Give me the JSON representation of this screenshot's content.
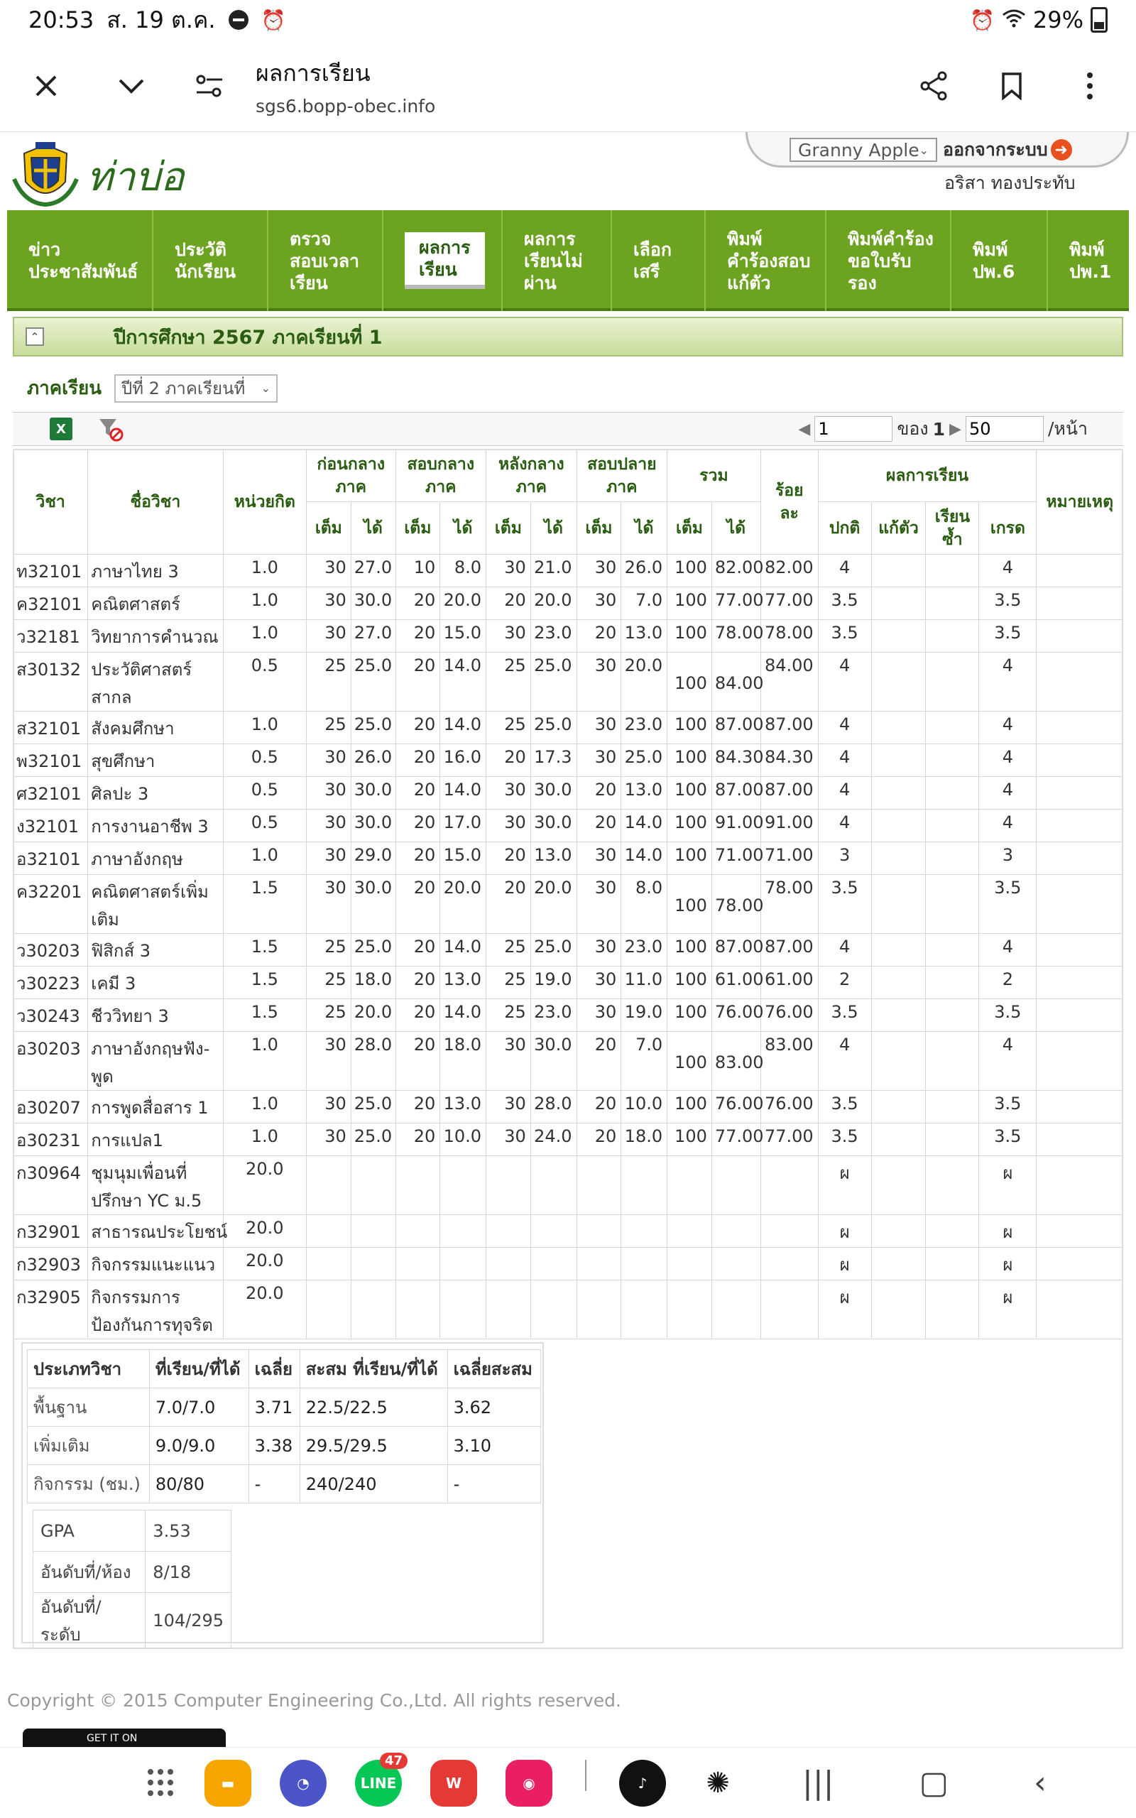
{
  "status": {
    "time": "20:53",
    "date": "ส. 19 ต.ค.",
    "battery": "29%"
  },
  "browser": {
    "page_title": "ผลการเรียน",
    "url": "sgs6.bopp-obec.info"
  },
  "site": {
    "name": "ท่าบ่อ",
    "theme": "Granny Apple",
    "logout": "ออกจากระบบ",
    "user": "อริสา  ทองประทับ"
  },
  "nav": [
    "ข่าว\nประชาสัมพันธ์",
    "ประวัติ\nนักเรียน",
    "ตรวจ\nสอบเวลา\nเรียน",
    "ผลการ\nเรียน",
    "ผลการ\nเรียนไม่\nผ่าน",
    "เลือก\nเสรี",
    "พิมพ์\nคำร้องสอบ\nแก้ตัว",
    "พิมพ์คำร้อง\nขอใบรับ\nรอง",
    "พิมพ์\nปพ.6",
    "พิมพ์\nปพ.1"
  ],
  "term_title": "ปีการศึกษา 2567  ภาคเรียนที่  1",
  "filter": {
    "label": "ภาคเรียน",
    "value": "ปีที่  2  ภาคเรียนที่"
  },
  "pager": {
    "page": "1",
    "of_label": "ของ",
    "total_pages": "1",
    "per_page": "50",
    "per_page_label": "/หน้า"
  },
  "table": {
    "headers": {
      "code": "วิชา",
      "name": "ชื่อวิชา",
      "credit": "หน่วยกิต",
      "pre_mid": "ก่อนกลาง\nภาค",
      "mid": "สอบกลาง\nภาค",
      "post_mid": "หลังกลาง\nภาค",
      "final": "สอบปลาย\nภาค",
      "total": "รวม",
      "percent": "ร้อย\nละ",
      "result": "ผลการเรียน",
      "note": "หมายเหตุ",
      "full": "เต็ม",
      "got": "ได้",
      "normal": "ปกติ",
      "retest": "แก้ตัว",
      "repeat": "เรียน\nซ้ำ",
      "grade": "เกรด"
    },
    "rows": [
      {
        "code": "ท32101",
        "name": "ภาษาไทย  3",
        "credit": "1.0",
        "s": [
          "30",
          "27.0",
          "10",
          "8.0",
          "30",
          "21.0",
          "30",
          "26.0",
          "100",
          "82.00"
        ],
        "pct": "82.00",
        "normal": "4",
        "retest": "",
        "repeat": "",
        "grade": "4",
        "note": ""
      },
      {
        "code": "ค32101",
        "name": "คณิตศาสตร์",
        "credit": "1.0",
        "s": [
          "30",
          "30.0",
          "20",
          "20.0",
          "20",
          "20.0",
          "30",
          "7.0",
          "100",
          "77.00"
        ],
        "pct": "77.00",
        "normal": "3.5",
        "retest": "",
        "repeat": "",
        "grade": "3.5",
        "note": ""
      },
      {
        "code": "ว32181",
        "name": "วิทยาการคำนวณ",
        "credit": "1.0",
        "s": [
          "30",
          "27.0",
          "20",
          "15.0",
          "30",
          "23.0",
          "20",
          "13.0",
          "100",
          "78.00"
        ],
        "pct": "78.00",
        "normal": "3.5",
        "retest": "",
        "repeat": "",
        "grade": "3.5",
        "note": ""
      },
      {
        "code": "ส30132",
        "name": "ประวัติศาสตร์สากล",
        "credit": "0.5",
        "s": [
          "25",
          "25.0",
          "20",
          "14.0",
          "25",
          "25.0",
          "30",
          "20.0",
          "100",
          "84.00"
        ],
        "pct": "84.00",
        "normal": "4",
        "retest": "",
        "repeat": "",
        "grade": "4",
        "note": "",
        "tall": true
      },
      {
        "code": "ส32101",
        "name": "สังคมศึกษา",
        "credit": "1.0",
        "s": [
          "25",
          "25.0",
          "20",
          "14.0",
          "25",
          "25.0",
          "30",
          "23.0",
          "100",
          "87.00"
        ],
        "pct": "87.00",
        "normal": "4",
        "retest": "",
        "repeat": "",
        "grade": "4",
        "note": ""
      },
      {
        "code": "พ32101",
        "name": "สุขศึกษา",
        "credit": "0.5",
        "s": [
          "30",
          "26.0",
          "20",
          "16.0",
          "20",
          "17.3",
          "30",
          "25.0",
          "100",
          "84.30"
        ],
        "pct": "84.30",
        "normal": "4",
        "retest": "",
        "repeat": "",
        "grade": "4",
        "note": ""
      },
      {
        "code": "ศ32101",
        "name": "ศิลปะ  3",
        "credit": "0.5",
        "s": [
          "30",
          "30.0",
          "20",
          "14.0",
          "30",
          "30.0",
          "20",
          "13.0",
          "100",
          "87.00"
        ],
        "pct": "87.00",
        "normal": "4",
        "retest": "",
        "repeat": "",
        "grade": "4",
        "note": ""
      },
      {
        "code": "ง32101",
        "name": "การงานอาชีพ  3",
        "credit": "0.5",
        "s": [
          "30",
          "30.0",
          "20",
          "17.0",
          "30",
          "30.0",
          "20",
          "14.0",
          "100",
          "91.00"
        ],
        "pct": "91.00",
        "normal": "4",
        "retest": "",
        "repeat": "",
        "grade": "4",
        "note": ""
      },
      {
        "code": "อ32101",
        "name": "ภาษาอังกฤษ",
        "credit": "1.0",
        "s": [
          "30",
          "29.0",
          "20",
          "15.0",
          "20",
          "13.0",
          "30",
          "14.0",
          "100",
          "71.00"
        ],
        "pct": "71.00",
        "normal": "3",
        "retest": "",
        "repeat": "",
        "grade": "3",
        "note": ""
      },
      {
        "code": "ค32201",
        "name": "คณิตศาสตร์เพิ่มเติม",
        "credit": "1.5",
        "s": [
          "30",
          "30.0",
          "20",
          "20.0",
          "20",
          "20.0",
          "30",
          "8.0",
          "100",
          "78.00"
        ],
        "pct": "78.00",
        "normal": "3.5",
        "retest": "",
        "repeat": "",
        "grade": "3.5",
        "note": "",
        "tall": true
      },
      {
        "code": "ว30203",
        "name": "ฟิสิกส์  3",
        "credit": "1.5",
        "s": [
          "25",
          "25.0",
          "20",
          "14.0",
          "25",
          "25.0",
          "30",
          "23.0",
          "100",
          "87.00"
        ],
        "pct": "87.00",
        "normal": "4",
        "retest": "",
        "repeat": "",
        "grade": "4",
        "note": ""
      },
      {
        "code": "ว30223",
        "name": "เคมี  3",
        "credit": "1.5",
        "s": [
          "25",
          "18.0",
          "20",
          "13.0",
          "25",
          "19.0",
          "30",
          "11.0",
          "100",
          "61.00"
        ],
        "pct": "61.00",
        "normal": "2",
        "retest": "",
        "repeat": "",
        "grade": "2",
        "note": ""
      },
      {
        "code": "ว30243",
        "name": "ชีววิทยา  3",
        "credit": "1.5",
        "s": [
          "25",
          "20.0",
          "20",
          "14.0",
          "25",
          "23.0",
          "30",
          "19.0",
          "100",
          "76.00"
        ],
        "pct": "76.00",
        "normal": "3.5",
        "retest": "",
        "repeat": "",
        "grade": "3.5",
        "note": ""
      },
      {
        "code": "อ30203",
        "name": "ภาษาอังกฤษฟัง-พูด",
        "credit": "1.0",
        "s": [
          "30",
          "28.0",
          "20",
          "18.0",
          "30",
          "30.0",
          "20",
          "7.0",
          "100",
          "83.00"
        ],
        "pct": "83.00",
        "normal": "4",
        "retest": "",
        "repeat": "",
        "grade": "4",
        "note": "",
        "tall": true
      },
      {
        "code": "อ30207",
        "name": "การพูดสื่อสาร  1",
        "credit": "1.0",
        "s": [
          "30",
          "25.0",
          "20",
          "13.0",
          "30",
          "28.0",
          "20",
          "10.0",
          "100",
          "76.00"
        ],
        "pct": "76.00",
        "normal": "3.5",
        "retest": "",
        "repeat": "",
        "grade": "3.5",
        "note": ""
      },
      {
        "code": "อ30231",
        "name": "การแปล1",
        "credit": "1.0",
        "s": [
          "30",
          "25.0",
          "20",
          "10.0",
          "30",
          "24.0",
          "20",
          "18.0",
          "100",
          "77.00"
        ],
        "pct": "77.00",
        "normal": "3.5",
        "retest": "",
        "repeat": "",
        "grade": "3.5",
        "note": ""
      },
      {
        "code": "ก30964",
        "name": "ชุมนุมเพื่อนที่ปรึกษา  YC ม.5",
        "credit": "20.0",
        "s": [
          "",
          "",
          "",
          "",
          "",
          "",
          "",
          "",
          "",
          ""
        ],
        "pct": "",
        "normal": "ผ",
        "retest": "",
        "repeat": "",
        "grade": "ผ",
        "note": "",
        "tall": true
      },
      {
        "code": "ก32901",
        "name": "สาธารณประโยชน์",
        "credit": "20.0",
        "s": [
          "",
          "",
          "",
          "",
          "",
          "",
          "",
          "",
          "",
          ""
        ],
        "pct": "",
        "normal": "ผ",
        "retest": "",
        "repeat": "",
        "grade": "ผ",
        "note": ""
      },
      {
        "code": "ก32903",
        "name": "กิจกรรมแนะแนว",
        "credit": "20.0",
        "s": [
          "",
          "",
          "",
          "",
          "",
          "",
          "",
          "",
          "",
          ""
        ],
        "pct": "",
        "normal": "ผ",
        "retest": "",
        "repeat": "",
        "grade": "ผ",
        "note": ""
      },
      {
        "code": "ก32905",
        "name": "กิจกรรมการป้องกันการทุจริต",
        "credit": "20.0",
        "s": [
          "",
          "",
          "",
          "",
          "",
          "",
          "",
          "",
          "",
          ""
        ],
        "pct": "",
        "normal": "ผ",
        "retest": "",
        "repeat": "",
        "grade": "ผ",
        "note": "",
        "tall": true
      }
    ]
  },
  "summary": {
    "headers": [
      "ประเภทวิชา",
      "ที่เรียน/ที่ได้",
      "เฉลี่ย",
      "สะสม  ที่เรียน/ที่ได้",
      "เฉลี่ยสะสม"
    ],
    "rows": [
      [
        "พื้นฐาน",
        "7.0/7.0",
        "3.71",
        "22.5/22.5",
        "3.62"
      ],
      [
        "เพิ่มเติม",
        "9.0/9.0",
        "3.38",
        "29.5/29.5",
        "3.10"
      ],
      [
        "กิจกรรม  (ชม.)",
        "80/80",
        "-",
        "240/240",
        "-"
      ]
    ],
    "gpa": [
      [
        "GPA",
        "3.53"
      ],
      [
        "อันดับที่/ห้อง",
        "8/18"
      ],
      [
        "อันดับที่/ระดับ",
        "104/295"
      ]
    ]
  },
  "copyright": "Copyright © 2015 Computer Engineering Co.,Ltd. All rights reserved.",
  "app_badge": "GET IT ON",
  "dock": {
    "line_badge": "47"
  },
  "colors": {
    "nav_green": "#6ca320",
    "header_green": "#2a5c12"
  }
}
